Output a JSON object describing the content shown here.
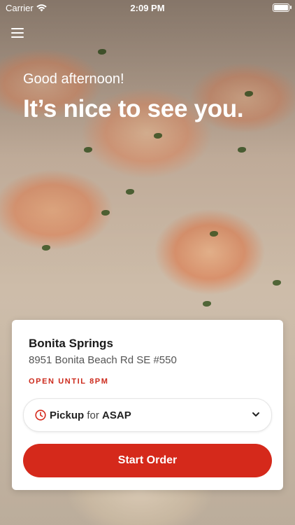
{
  "status_bar": {
    "carrier": "Carrier",
    "time": "2:09 PM",
    "battery_level": 1.0
  },
  "colors": {
    "accent": "#d5291b",
    "hours_text": "#cc2a1c"
  },
  "header": {
    "menu_icon": "hamburger-menu-icon"
  },
  "hero": {
    "greeting": "Good afternoon!",
    "headline": "It’s nice to see you."
  },
  "location": {
    "name": "Bonita Springs",
    "address": "8951 Bonita Beach Rd SE #550",
    "hours": "OPEN UNTIL 8PM"
  },
  "order_type": {
    "icon": "clock-icon",
    "mode": "Pickup",
    "connector": "for",
    "time": "ASAP",
    "chevron_icon": "chevron-down-icon"
  },
  "actions": {
    "start_order": "Start Order"
  }
}
